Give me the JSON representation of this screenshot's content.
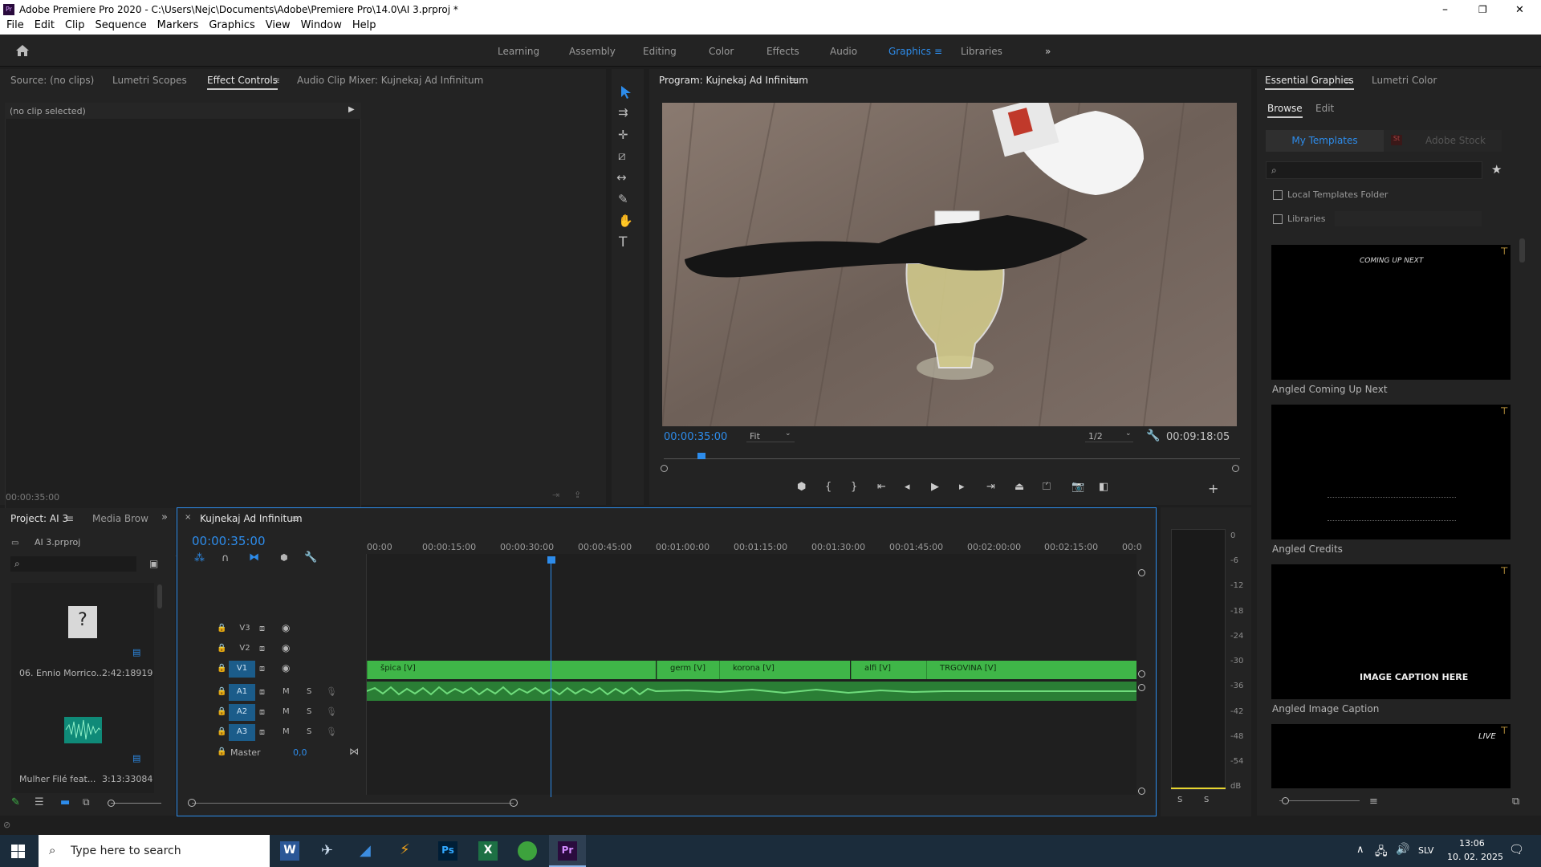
{
  "window": {
    "title": "Adobe Premiere Pro 2020 - C:\\Users\\Nejc\\Documents\\Adobe\\Premiere Pro\\14.0\\AI 3.prproj *",
    "min": "–",
    "max": "❐",
    "close": "✕"
  },
  "menu": [
    "File",
    "Edit",
    "Clip",
    "Sequence",
    "Markers",
    "Graphics",
    "View",
    "Window",
    "Help"
  ],
  "workspaces": [
    "Learning",
    "Assembly",
    "Editing",
    "Color",
    "Effects",
    "Audio",
    "Graphics",
    "Libraries"
  ],
  "workspace_active": "Graphics",
  "source_tabs": [
    "Source: (no clips)",
    "Lumetri Scopes",
    "Effect Controls",
    "Audio Clip Mixer: Kujnekaj Ad Infinitum"
  ],
  "effect_controls": {
    "no_clip": "(no clip selected)",
    "timecode": "00:00:35:00"
  },
  "program": {
    "title": "Program: Kujnekaj Ad Infinitum",
    "timecode": "00:00:35:00",
    "fit": "Fit",
    "resolution": "1/2",
    "duration": "00:09:18:05"
  },
  "project": {
    "tabs": [
      "Project: AI 3",
      "Media Brow"
    ],
    "file": "AI 3.prproj",
    "items": [
      {
        "name": "06. Ennio Morrico...",
        "duration": "2:42:18919"
      },
      {
        "name": "Mulher Filé feat...",
        "duration": "3:13:33084"
      }
    ]
  },
  "timeline": {
    "tab": "Kujnekaj Ad Infinitum",
    "timecode": "00:00:35:00",
    "ruler": [
      "00:00",
      "00:00:15:00",
      "00:00:30:00",
      "00:00:45:00",
      "00:01:00:00",
      "00:01:15:00",
      "00:01:30:00",
      "00:01:45:00",
      "00:02:00:00",
      "00:02:15:00",
      "00:0"
    ],
    "tracks": [
      "V3",
      "V2",
      "V1",
      "A1",
      "A2",
      "A3"
    ],
    "master": "Master",
    "master_val": "0,0",
    "clips": [
      "špica [V]",
      "germ [V]",
      "korona [V]",
      "alfi [V]",
      "TRGOVINA [V]"
    ]
  },
  "meter": {
    "scale": [
      "0",
      "-6",
      "-12",
      "-18",
      "-24",
      "-30",
      "-36",
      "-42",
      "-48",
      "-54",
      "dB"
    ],
    "solo": [
      "S",
      "S"
    ]
  },
  "essential": {
    "tabs": [
      "Essential Graphics",
      "Lumetri Color"
    ],
    "sub": [
      "Browse",
      "Edit"
    ],
    "sources": [
      "My Templates",
      "Adobe Stock"
    ],
    "local": "Local Templates Folder",
    "libraries": "Libraries",
    "templates": [
      {
        "name": "Angled Coming Up Next",
        "text": "COMING UP NEXT"
      },
      {
        "name": "Angled Credits",
        "text": ""
      },
      {
        "name": "Angled Image Caption",
        "text": "IMAGE CAPTION HERE"
      },
      {
        "name": "",
        "text": "LIVE"
      }
    ]
  },
  "taskbar": {
    "search": "Type here to search",
    "time": "13:06",
    "date": "10. 02. 2025",
    "lang": "SLV"
  }
}
